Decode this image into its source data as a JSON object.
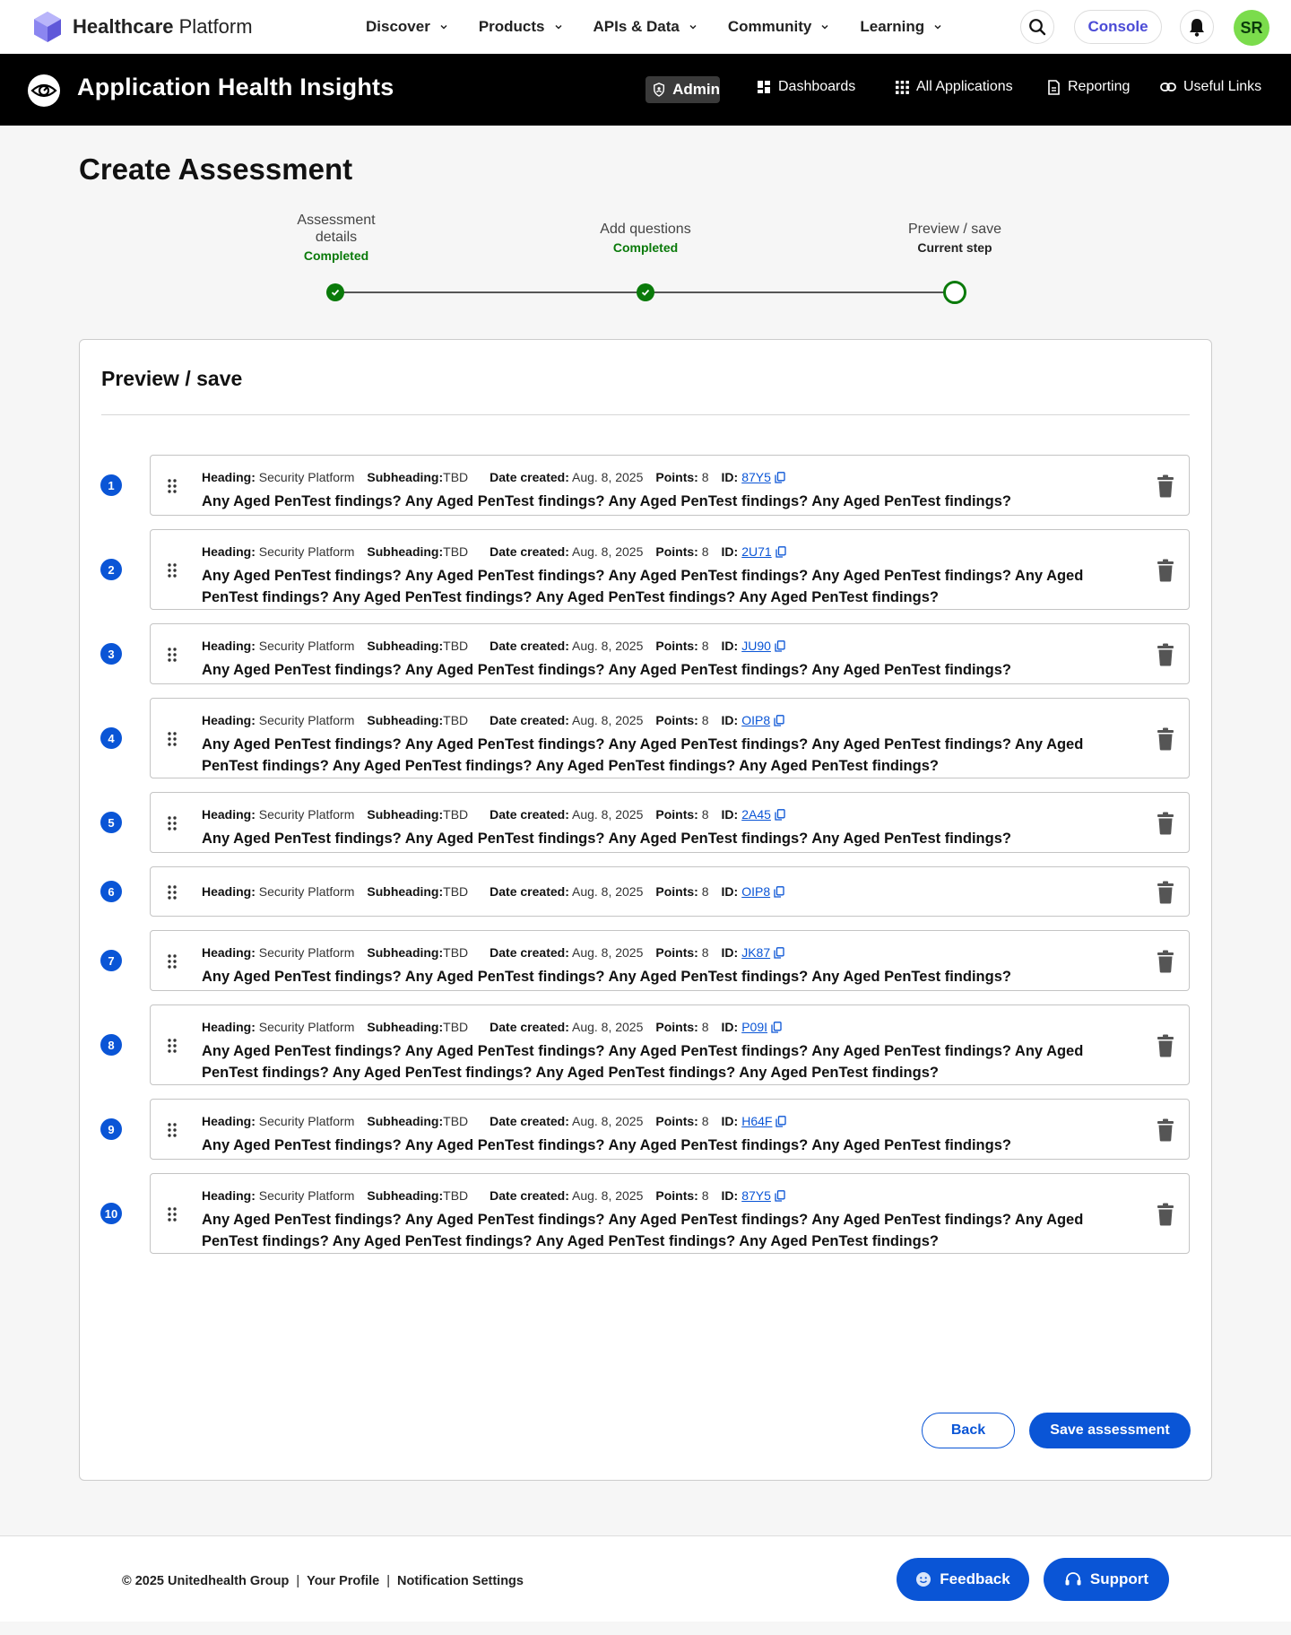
{
  "topnav": {
    "brand_bold": "Healthcare",
    "brand_rest": " Platform",
    "menu": [
      "Discover",
      "Products",
      "APIs & Data",
      "Community",
      "Learning"
    ],
    "console_label": "Console",
    "avatar_initials": "SR"
  },
  "appbar": {
    "title": "Application Health Insights",
    "admin_label": "Admin",
    "nav": [
      "Dashboards",
      "All Applications",
      "Reporting",
      "Useful Links"
    ]
  },
  "page": {
    "title": "Create Assessment"
  },
  "stepper": {
    "steps": [
      {
        "label": "Assessment details",
        "status": "Completed"
      },
      {
        "label": "Add questions",
        "status": "Completed"
      },
      {
        "label": "Preview / save",
        "status": "Current step"
      }
    ]
  },
  "preview": {
    "title": "Preview / save",
    "meta_labels": {
      "heading": "Heading:",
      "subheading": "Subheading:",
      "date": "Date created:",
      "points": "Points:",
      "id": "ID:"
    },
    "questions": [
      {
        "num": "1",
        "heading": "Security Platform",
        "subheading": "TBD",
        "date": "Aug. 8, 2025",
        "points": "8",
        "id": "87Y5",
        "text": "Any Aged PenTest findings? Any Aged PenTest findings? Any Aged PenTest findings? Any Aged PenTest findings?"
      },
      {
        "num": "2",
        "heading": "Security Platform",
        "subheading": "TBD",
        "date": "Aug. 8, 2025",
        "points": "8",
        "id": "2U71",
        "text": "Any Aged PenTest findings? Any Aged PenTest findings? Any Aged PenTest findings? Any Aged PenTest findings? Any Aged PenTest findings? Any Aged PenTest findings? Any Aged PenTest findings? Any Aged PenTest findings?"
      },
      {
        "num": "3",
        "heading": "Security Platform",
        "subheading": "TBD",
        "date": "Aug. 8, 2025",
        "points": "8",
        "id": "JU90",
        "text": "Any Aged PenTest findings? Any Aged PenTest findings? Any Aged PenTest findings? Any Aged PenTest findings?"
      },
      {
        "num": "4",
        "heading": "Security Platform",
        "subheading": "TBD",
        "date": "Aug. 8, 2025",
        "points": "8",
        "id": "OIP8",
        "text": "Any Aged PenTest findings? Any Aged PenTest findings? Any Aged PenTest findings? Any Aged PenTest findings? Any Aged PenTest findings? Any Aged PenTest findings? Any Aged PenTest findings? Any Aged PenTest findings?"
      },
      {
        "num": "5",
        "heading": "Security Platform",
        "subheading": "TBD",
        "date": "Aug. 8, 2025",
        "points": "8",
        "id": "2A45",
        "text": "Any Aged PenTest findings? Any Aged PenTest findings? Any Aged PenTest findings? Any Aged PenTest findings?"
      },
      {
        "num": "6",
        "heading": "Security Platform",
        "subheading": "TBD",
        "date": "Aug. 8, 2025",
        "points": "8",
        "id": "OIP8",
        "text": ""
      },
      {
        "num": "7",
        "heading": "Security Platform",
        "subheading": "TBD",
        "date": "Aug. 8, 2025",
        "points": "8",
        "id": "JK87",
        "text": "Any Aged PenTest findings? Any Aged PenTest findings? Any Aged PenTest findings? Any Aged PenTest findings?"
      },
      {
        "num": "8",
        "heading": "Security Platform",
        "subheading": "TBD",
        "date": "Aug. 8, 2025",
        "points": "8",
        "id": "P09I",
        "text": "Any Aged PenTest findings? Any Aged PenTest findings? Any Aged PenTest findings? Any Aged PenTest findings? Any Aged PenTest findings? Any Aged PenTest findings? Any Aged PenTest findings? Any Aged PenTest findings?"
      },
      {
        "num": "9",
        "heading": "Security Platform",
        "subheading": "TBD",
        "date": "Aug. 8, 2025",
        "points": "8",
        "id": "H64F",
        "text": "Any Aged PenTest findings? Any Aged PenTest findings? Any Aged PenTest findings? Any Aged PenTest findings?"
      },
      {
        "num": "10",
        "heading": "Security Platform",
        "subheading": "TBD",
        "date": "Aug. 8, 2025",
        "points": "8",
        "id": "87Y5",
        "text": "Any Aged PenTest findings? Any Aged PenTest findings? Any Aged PenTest findings? Any Aged PenTest findings? Any Aged PenTest findings? Any Aged PenTest findings? Any Aged PenTest findings? Any Aged PenTest findings?"
      }
    ],
    "back_label": "Back",
    "save_label": "Save assessment"
  },
  "footer": {
    "copyright": "© 2025 Unitedhealth Group",
    "profile_link": "Your Profile",
    "notifications_link": "Notification Settings",
    "feedback_label": "Feedback",
    "support_label": "Support"
  },
  "colors": {
    "primary": "#0a55d6",
    "success": "#0a7a0a",
    "appbar_bg": "#000000",
    "avatar_bg": "#7bdc4c",
    "console_text": "#4b4bd6"
  },
  "icons": [
    "hexagon-logo-icon",
    "chevron-down-icon",
    "search-icon",
    "bell-icon",
    "eye-logo-icon",
    "shield-icon",
    "dashboard-icon",
    "grid-icon",
    "report-icon",
    "link-icon",
    "check-icon",
    "drag-handle-icon",
    "copy-icon",
    "trash-icon",
    "smile-icon",
    "headset-icon"
  ]
}
